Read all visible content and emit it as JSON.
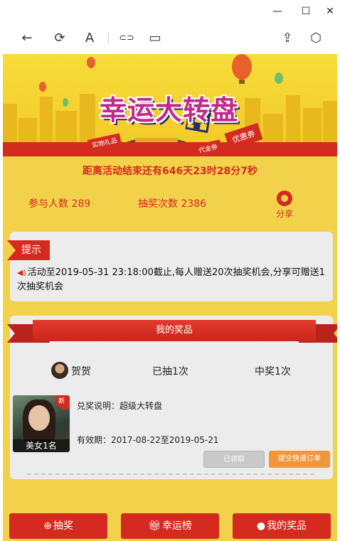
{
  "window": {
    "minimize_glyph": "—",
    "maximize_glyph": "☐",
    "close_glyph": "✕"
  },
  "toolbar": {
    "back_glyph": "←",
    "refresh_glyph": "⟳",
    "text_glyph": "A",
    "link_glyph": "⊂⊃",
    "layout_glyph": "▭",
    "share_glyph": "⇪",
    "package_glyph": "⬡"
  },
  "banner": {
    "title": "幸运大转盘",
    "tag_physical": "实物礼品",
    "tag_voucher": "代金券",
    "tag_coupon": "优惠券"
  },
  "countdown": "距离活动结束还有646天23时28分7秒",
  "stats": {
    "participants_label": "参与人数",
    "participants_value": "289",
    "draws_label": "抽奖次数",
    "draws_value": "2386",
    "share_label": "分享"
  },
  "tip": {
    "badge": "提示",
    "text": "活动至2019-05-31 23:18:00截止,每人赠送20次抽奖机会,分享可赠送1次抽奖机会"
  },
  "prizes": {
    "ribbon_title": "我的奖品",
    "user_name": "贺贺",
    "drawn": "已抽1次",
    "won": "中奖1次",
    "item": {
      "badge": "新",
      "caption": "美女1名",
      "redeem": "兑奖说明：超级大转盘",
      "validity": "有效期：2017-08-22至2019-05-21",
      "claimed_label": "已领取",
      "submit_label": "提交快递订单"
    }
  },
  "bottom_nav": {
    "draw": "抽奖",
    "ranking": "幸运榜",
    "my_prizes": "我的奖品"
  },
  "colors": {
    "page_bg": "#f2d24b",
    "accent_red": "#d42a20",
    "orange": "#f0963c"
  }
}
